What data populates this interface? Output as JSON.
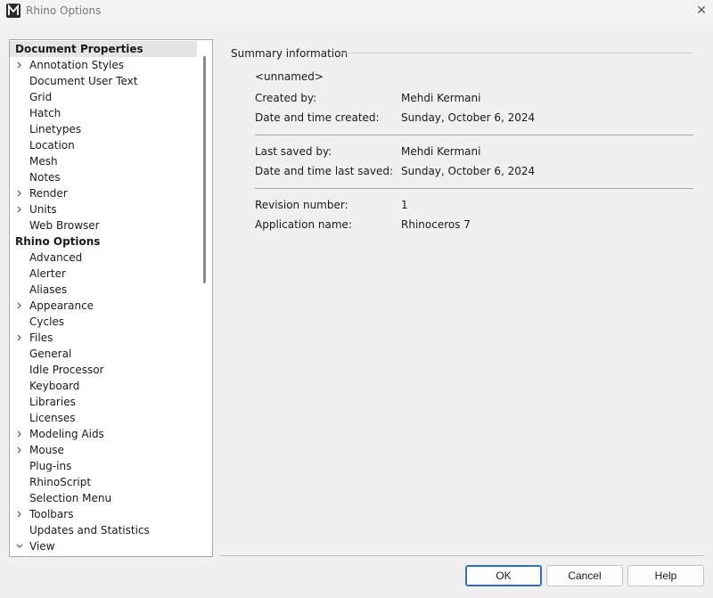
{
  "window": {
    "title": "Rhino Options",
    "app_icon": "rhino-logo-icon",
    "close_icon": "close-icon"
  },
  "tree": {
    "items": [
      {
        "label": "Document Properties",
        "header": true,
        "selected": true,
        "chevron": ""
      },
      {
        "label": "Annotation Styles",
        "chevron": "right"
      },
      {
        "label": "Document User Text",
        "chevron": ""
      },
      {
        "label": "Grid",
        "chevron": ""
      },
      {
        "label": "Hatch",
        "chevron": ""
      },
      {
        "label": "Linetypes",
        "chevron": ""
      },
      {
        "label": "Location",
        "chevron": ""
      },
      {
        "label": "Mesh",
        "chevron": ""
      },
      {
        "label": "Notes",
        "chevron": ""
      },
      {
        "label": "Render",
        "chevron": "right"
      },
      {
        "label": "Units",
        "chevron": "right"
      },
      {
        "label": "Web Browser",
        "chevron": ""
      },
      {
        "label": "Rhino Options",
        "header": true,
        "chevron": ""
      },
      {
        "label": "Advanced",
        "chevron": ""
      },
      {
        "label": "Alerter",
        "chevron": ""
      },
      {
        "label": "Aliases",
        "chevron": ""
      },
      {
        "label": "Appearance",
        "chevron": "right"
      },
      {
        "label": "Cycles",
        "chevron": ""
      },
      {
        "label": "Files",
        "chevron": "right"
      },
      {
        "label": "General",
        "chevron": ""
      },
      {
        "label": "Idle Processor",
        "chevron": ""
      },
      {
        "label": "Keyboard",
        "chevron": ""
      },
      {
        "label": "Libraries",
        "chevron": ""
      },
      {
        "label": "Licenses",
        "chevron": ""
      },
      {
        "label": "Modeling Aids",
        "chevron": "right"
      },
      {
        "label": "Mouse",
        "chevron": "right"
      },
      {
        "label": "Plug-ins",
        "chevron": ""
      },
      {
        "label": "RhinoScript",
        "chevron": ""
      },
      {
        "label": "Selection Menu",
        "chevron": ""
      },
      {
        "label": "Toolbars",
        "chevron": "right"
      },
      {
        "label": "Updates and Statistics",
        "chevron": ""
      },
      {
        "label": "View",
        "chevron": "down"
      }
    ]
  },
  "summary": {
    "group_title": "Summary information",
    "doc_name": "<unnamed>",
    "created_by_label": "Created by:",
    "created_by": "Mehdi Kermani",
    "created_date_label": "Date and time created:",
    "created_date": "Sunday, October 6, 2024",
    "saved_by_label": "Last saved by:",
    "saved_by": "Mehdi Kermani",
    "saved_date_label": "Date and time last saved:",
    "saved_date": "Sunday, October 6, 2024",
    "revision_label": "Revision number:",
    "revision": "1",
    "app_label": "Application name:",
    "app": "Rhinoceros 7"
  },
  "buttons": {
    "ok": "OK",
    "cancel": "Cancel",
    "help": "Help"
  },
  "colors": {
    "accent": "#2f6fb3",
    "selection": "#e5e5e5"
  }
}
